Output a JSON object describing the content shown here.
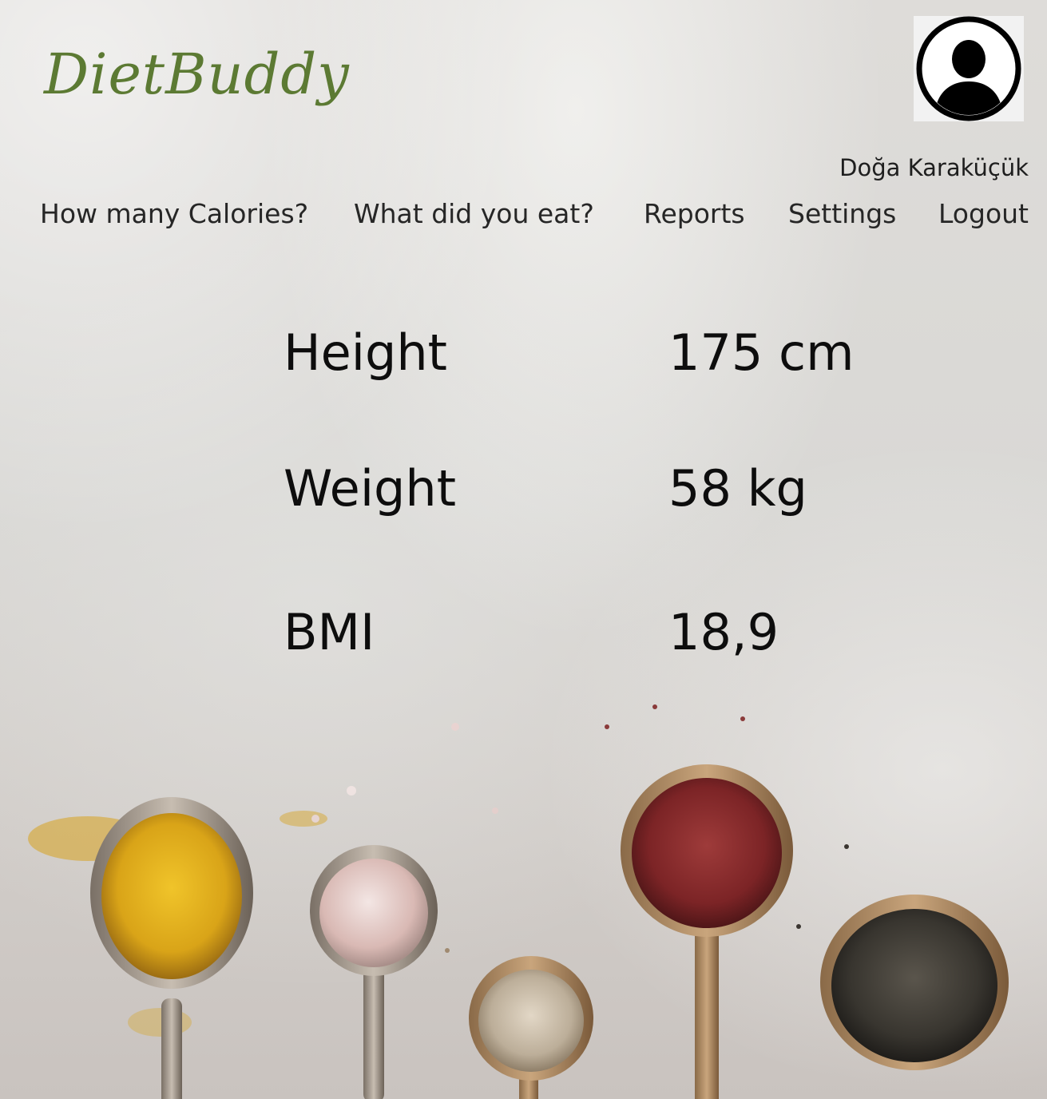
{
  "app": {
    "title": "DietBuddy"
  },
  "user": {
    "name": "Doğa Karaküçük",
    "avatar_icon": "user-avatar-icon"
  },
  "nav": [
    {
      "label": "How many Calories?"
    },
    {
      "label": "What did you eat?"
    },
    {
      "label": "Reports"
    },
    {
      "label": "Settings"
    },
    {
      "label": "Logout"
    }
  ],
  "stats": [
    {
      "label": "Height",
      "value": "175 cm"
    },
    {
      "label": "Weight",
      "value": "58 kg"
    },
    {
      "label": "BMI",
      "value": "18,9"
    }
  ],
  "colors": {
    "logo": "#5c7a33",
    "text": "#0d0d0d"
  },
  "background_image": "spices-in-spoons"
}
